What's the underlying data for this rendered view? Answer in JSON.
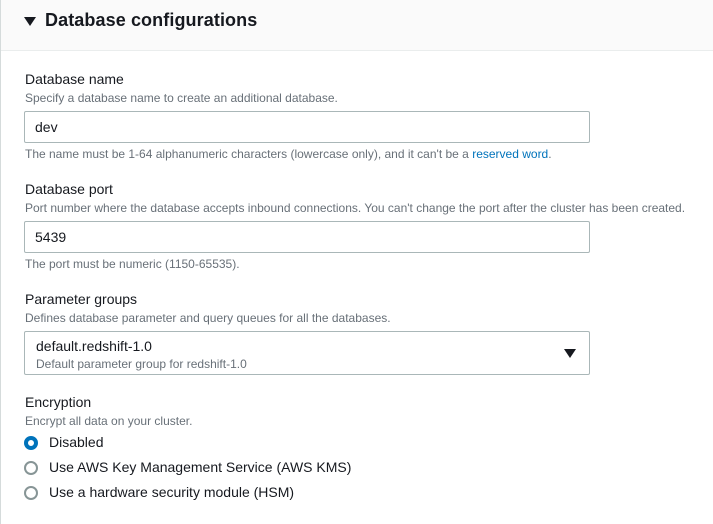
{
  "section": {
    "title": "Database configurations"
  },
  "database_name": {
    "label": "Database name",
    "description": "Specify a database name to create an additional database.",
    "value": "dev",
    "hint_text": "The name must be 1-64 alphanumeric characters (lowercase only), and it can't be a",
    "hint_link": "reserved word",
    "hint_end": "."
  },
  "database_port": {
    "label": "Database port",
    "description": "Port number where the database accepts inbound connections. You can't change the port after the cluster has been created.",
    "value": "5439",
    "hint": "The port must be numeric (1150-65535)."
  },
  "parameter_groups": {
    "label": "Parameter groups",
    "description": "Defines database parameter and query queues for all the databases.",
    "selected_title": "default.redshift-1.0",
    "selected_description": "Default parameter group for redshift-1.0"
  },
  "encryption": {
    "label": "Encryption",
    "description": "Encrypt all data on your cluster.",
    "options": [
      {
        "label": "Disabled",
        "checked": true
      },
      {
        "label": "Use AWS Key Management Service (AWS KMS)",
        "checked": false
      },
      {
        "label": "Use a hardware security module (HSM)",
        "checked": false
      }
    ]
  },
  "colors": {
    "accent": "#0073bb",
    "text": "#16191f",
    "muted": "#687078",
    "border": "#aab7b8"
  }
}
